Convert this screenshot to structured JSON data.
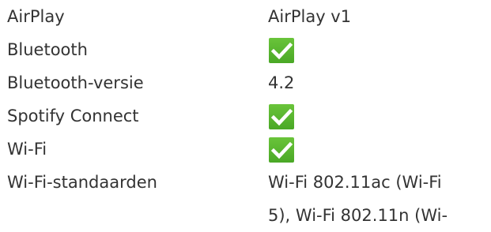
{
  "specs": [
    {
      "label": "AirPlay",
      "value": "AirPlay v1"
    },
    {
      "label": "Bluetooth",
      "value_icon": "checkmark-icon"
    },
    {
      "label": "Bluetooth-versie",
      "value": "4.2"
    },
    {
      "label": "Spotify Connect",
      "value_icon": "checkmark-icon"
    },
    {
      "label": "Wi-Fi",
      "value_icon": "checkmark-icon"
    },
    {
      "label": "Wi-Fi-standaarden",
      "value": "Wi-Fi 802.11ac (Wi-Fi 5), Wi-Fi 802.11n (Wi-"
    }
  ],
  "colors": {
    "text": "#333333",
    "check_green": "#5cb82e",
    "check_mark": "#ffffff"
  }
}
